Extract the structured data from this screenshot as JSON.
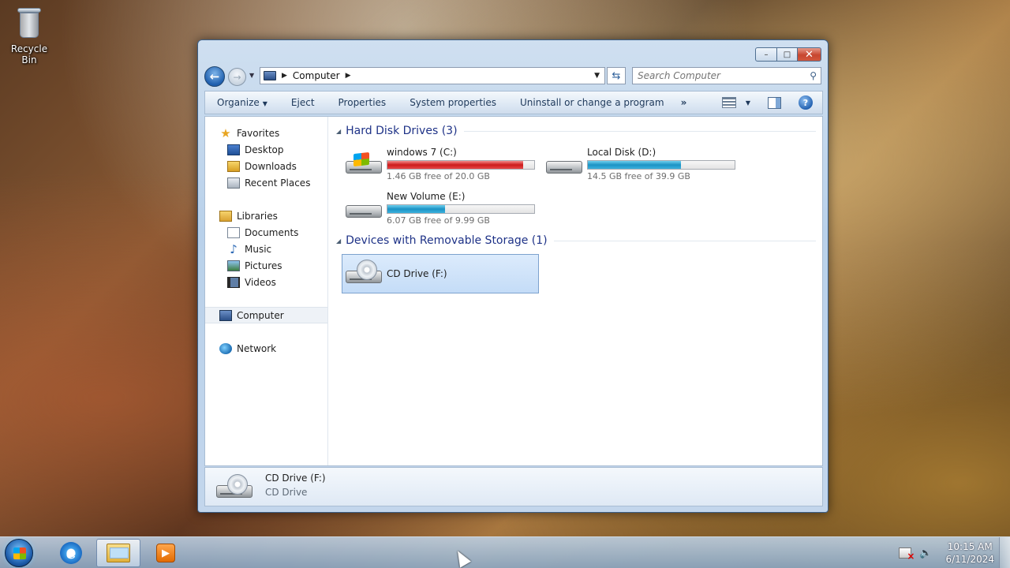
{
  "desktop": {
    "recycle_bin_label": "Recycle Bin"
  },
  "window": {
    "caption": {
      "minimize_glyph": "–",
      "maximize_glyph": "□",
      "close_glyph": "✕"
    },
    "address": {
      "breadcrumb": "Computer"
    },
    "search": {
      "placeholder": "Search Computer"
    },
    "toolbar": {
      "organize": "Organize",
      "eject": "Eject",
      "properties": "Properties",
      "system_properties": "System properties",
      "uninstall": "Uninstall or change a program",
      "more": "»"
    },
    "nav": {
      "favorites": "Favorites",
      "desktop": "Desktop",
      "downloads": "Downloads",
      "recent_places": "Recent Places",
      "libraries": "Libraries",
      "documents": "Documents",
      "music": "Music",
      "pictures": "Pictures",
      "videos": "Videos",
      "computer": "Computer",
      "network": "Network"
    },
    "groups": {
      "hard_disks": "Hard Disk Drives (3)",
      "removable": "Devices with Removable Storage (1)"
    },
    "drives": [
      {
        "name": "windows 7 (C:)",
        "free": "1.46 GB free of 20.0 GB",
        "used_fraction": 0.927,
        "bar_color": "#cc1b1b"
      },
      {
        "name": "Local Disk (D:)",
        "free": "14.5 GB free of 39.9 GB",
        "used_fraction": 0.637,
        "bar_color": "#1c93c4"
      },
      {
        "name": "New Volume (E:)",
        "free": "6.07 GB free of 9.99 GB",
        "used_fraction": 0.392,
        "bar_color": "#1c93c4"
      },
      {
        "name": "CD Drive (F:)"
      }
    ],
    "details": {
      "title": "CD Drive (F:)",
      "subtitle": "CD Drive"
    }
  },
  "taskbar": {
    "time": "10:15 AM",
    "date": "6/11/2024",
    "ie_glyph": "e",
    "media_glyph": "▶"
  }
}
